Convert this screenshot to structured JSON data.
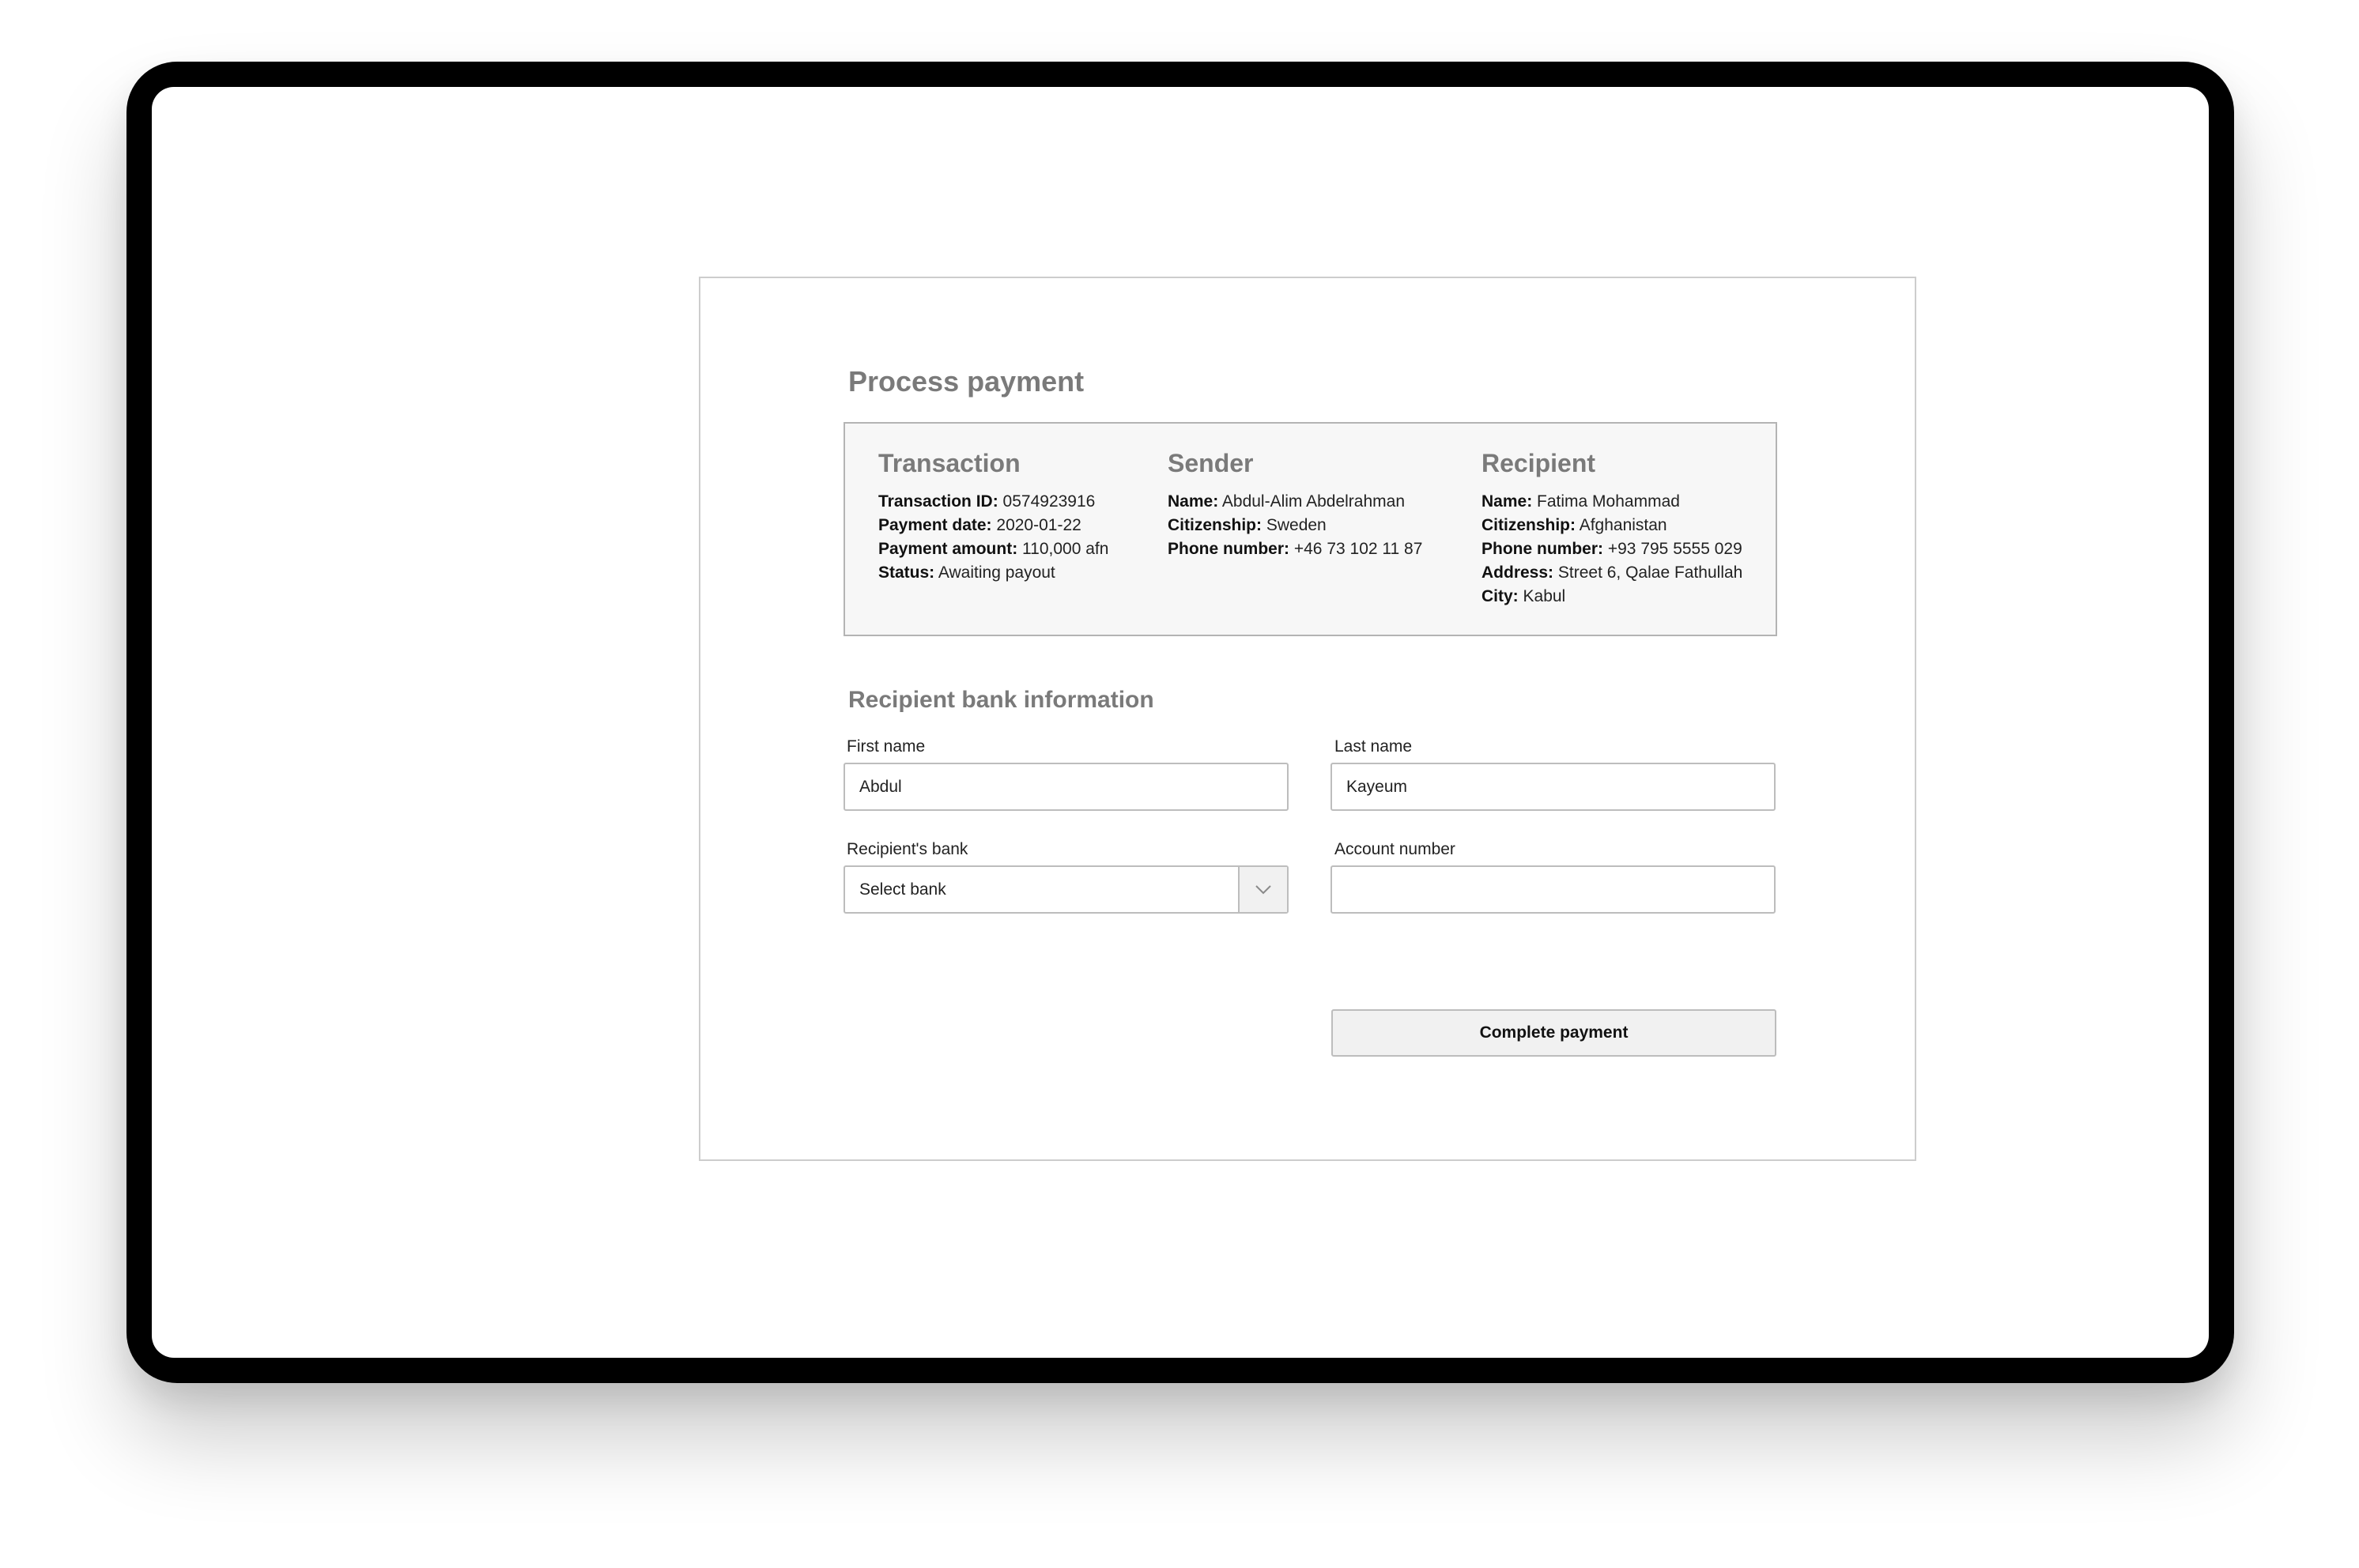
{
  "page": {
    "title": "Process payment"
  },
  "summary": {
    "transaction": {
      "title": "Transaction",
      "rows": [
        {
          "label": "Transaction ID:",
          "value": "0574923916"
        },
        {
          "label": "Payment date:",
          "value": "2020-01-22"
        },
        {
          "label": "Payment amount:",
          "value": "110,000 afn"
        },
        {
          "label": "Status:",
          "value": "Awaiting payout"
        }
      ]
    },
    "sender": {
      "title": "Sender",
      "rows": [
        {
          "label": "Name:",
          "value": "Abdul-Alim Abdelrahman"
        },
        {
          "label": "Citizenship:",
          "value": "Sweden"
        },
        {
          "label": "Phone number:",
          "value": "+46 73 102 11 87"
        }
      ]
    },
    "recipient": {
      "title": "Recipient",
      "rows": [
        {
          "label": "Name:",
          "value": "Fatima Mohammad"
        },
        {
          "label": "Citizenship:",
          "value": "Afghanistan"
        },
        {
          "label": "Phone number:",
          "value": "+93 795 5555 029"
        },
        {
          "label": "Address:",
          "value": "Street 6, Qalae Fathullah"
        },
        {
          "label": "City:",
          "value": "Kabul"
        }
      ]
    }
  },
  "bank_form": {
    "title": "Recipient bank information",
    "first_name": {
      "label": "First name",
      "value": "Abdul"
    },
    "last_name": {
      "label": "Last name",
      "value": "Kayeum"
    },
    "bank": {
      "label": "Recipient's bank",
      "value": "Select bank"
    },
    "account_number": {
      "label": "Account number",
      "value": ""
    },
    "submit_label": "Complete payment"
  },
  "icons": {
    "select_arrow": "chevron-down-icon"
  }
}
